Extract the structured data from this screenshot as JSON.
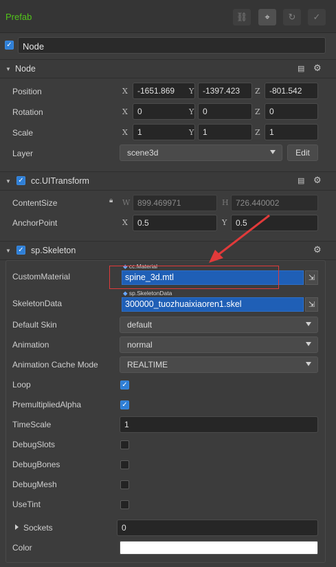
{
  "header": {
    "title": "Prefab"
  },
  "node": {
    "name": "Node"
  },
  "node_section": {
    "title": "Node",
    "position": {
      "label": "Position",
      "x": "-1651.869",
      "y": "-1397.423",
      "z": "-801.542"
    },
    "rotation": {
      "label": "Rotation",
      "x": "0",
      "y": "0",
      "z": "0"
    },
    "scale": {
      "label": "Scale",
      "x": "1",
      "y": "1",
      "z": "1"
    },
    "layer": {
      "label": "Layer",
      "value": "scene3d",
      "edit_label": "Edit"
    },
    "axes": {
      "x": "X",
      "y": "Y",
      "z": "Z"
    }
  },
  "uitransform": {
    "title": "cc.UITransform",
    "content_size": {
      "label": "ContentSize",
      "w_axis": "W",
      "h_axis": "H",
      "w": "899.469971",
      "h": "726.440002"
    },
    "anchor_point": {
      "label": "AnchorPoint",
      "x": "0.5",
      "y": "0.5"
    }
  },
  "skeleton": {
    "title": "sp.Skeleton",
    "custom_material": {
      "label": "CustomMaterial",
      "type": "cc.Material",
      "value": "spine_3d.mtl"
    },
    "skeleton_data": {
      "label": "SkeletonData",
      "type": "sp.SkeletonData",
      "value": "300000_tuozhuaixiaoren1.skel"
    },
    "default_skin": {
      "label": "Default Skin",
      "value": "default"
    },
    "animation": {
      "label": "Animation",
      "value": "normal"
    },
    "cache_mode": {
      "label": "Animation Cache Mode",
      "value": "REALTIME"
    },
    "loop": {
      "label": "Loop",
      "checked": true
    },
    "premultiplied": {
      "label": "PremultipliedAlpha",
      "checked": true
    },
    "timescale": {
      "label": "TimeScale",
      "value": "1"
    },
    "debug_slots": {
      "label": "DebugSlots",
      "checked": false
    },
    "debug_bones": {
      "label": "DebugBones",
      "checked": false
    },
    "debug_mesh": {
      "label": "DebugMesh",
      "checked": false
    },
    "use_tint": {
      "label": "UseTint",
      "checked": false
    },
    "sockets": {
      "label": "Sockets",
      "value": "0"
    },
    "color": {
      "label": "Color",
      "value": "#ffffff"
    }
  },
  "annotation": {
    "highlight_color": "#e03a3a"
  }
}
